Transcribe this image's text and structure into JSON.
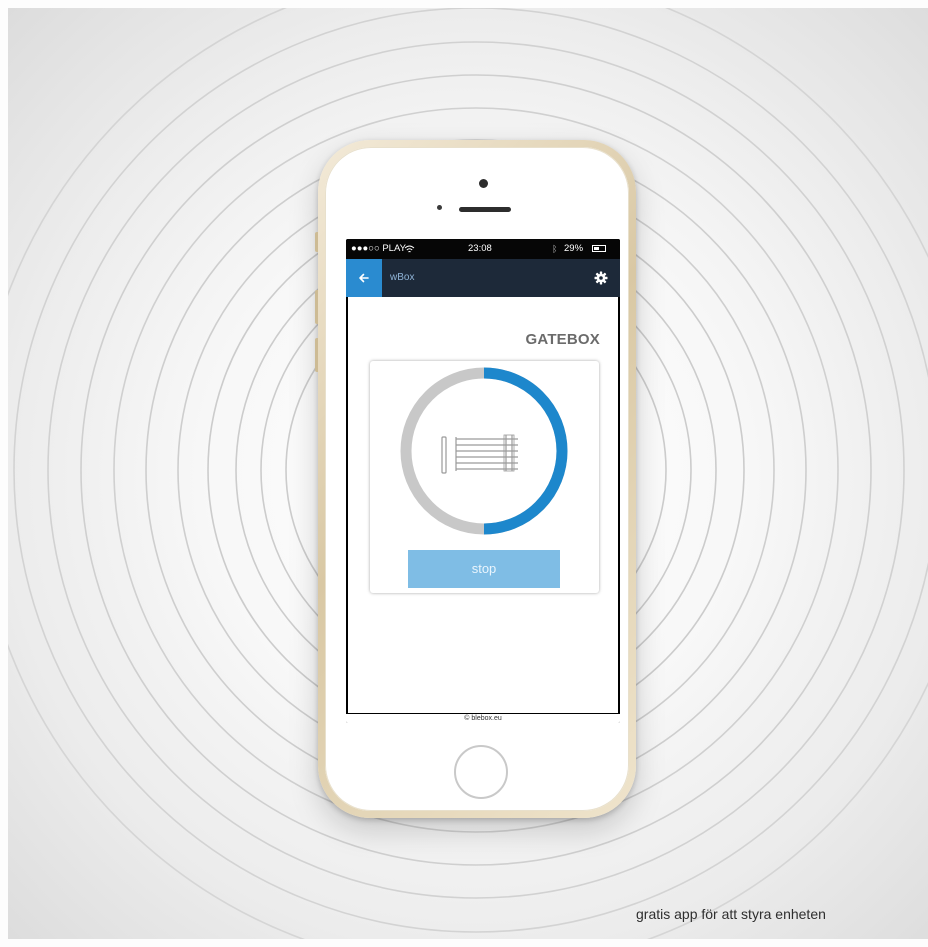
{
  "status_bar": {
    "carrier": "●●●○○ PLAY",
    "time": "23:08",
    "battery": "29%"
  },
  "app_header": {
    "back_icon": "arrow-left-icon",
    "title": "wBox",
    "settings_icon": "gear-icon"
  },
  "device": {
    "name": "GATEBOX",
    "gate_icon": "gate-icon",
    "open_progress": 0.5,
    "stop_label": "stop"
  },
  "footer": {
    "copyright": "© blebox.eu"
  },
  "caption": "gratis app för att styra enheten",
  "colors": {
    "accent": "#1d87cc",
    "header_bg": "#1d2939",
    "back_button_bg": "#2a8bd0",
    "stop_button_bg": "#7fbde5",
    "gauge_track": "#c8c8c8"
  }
}
